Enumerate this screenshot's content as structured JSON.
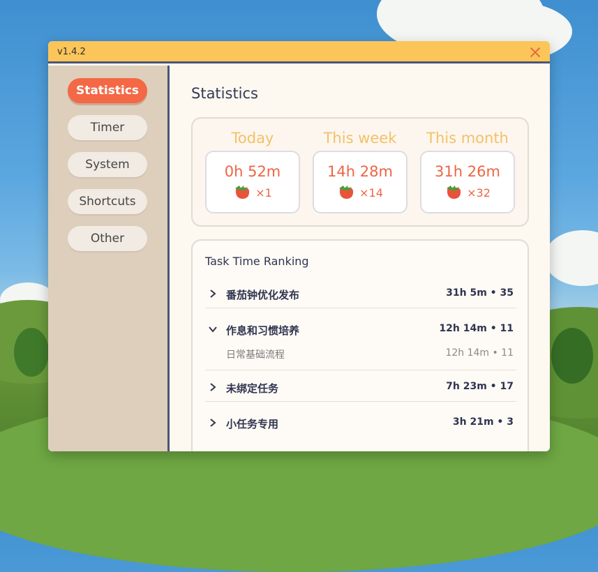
{
  "window": {
    "version": "v1.4.2",
    "close_icon": "close-icon"
  },
  "sidebar": {
    "items": [
      {
        "label": "Statistics",
        "active": true
      },
      {
        "label": "Timer",
        "active": false
      },
      {
        "label": "System",
        "active": false
      },
      {
        "label": "Shortcuts",
        "active": false
      },
      {
        "label": "Other",
        "active": false
      }
    ]
  },
  "main": {
    "title": "Statistics",
    "stats": [
      {
        "label": "Today",
        "time": "0h 52m",
        "count": "×1",
        "icon": "tomato-icon"
      },
      {
        "label": "This week",
        "time": "14h 28m",
        "count": "×14",
        "icon": "tomato-icon"
      },
      {
        "label": "This month",
        "time": "31h 26m",
        "count": "×32",
        "icon": "tomato-icon"
      }
    ],
    "ranking": {
      "title": "Task Time Ranking",
      "rows": [
        {
          "name": "番茄钟优化发布",
          "stat": "31h 5m • 35",
          "expanded": false
        },
        {
          "name": "作息和习惯培养",
          "stat": "12h 14m • 11",
          "expanded": true,
          "children": [
            {
              "name": "日常基础流程",
              "stat": "12h 14m • 11"
            }
          ]
        },
        {
          "name": "未绑定任务",
          "stat": "7h 23m • 17",
          "expanded": false
        },
        {
          "name": "小任务专用",
          "stat": "3h 21m • 3",
          "expanded": false
        }
      ]
    }
  },
  "colors": {
    "accent": "#f46845",
    "titlebar": "#fbc55a",
    "sidebar_bg": "#ddcfbb",
    "period_label": "#f3c169",
    "value_red": "#ec6545",
    "divider": "#4b5578"
  }
}
